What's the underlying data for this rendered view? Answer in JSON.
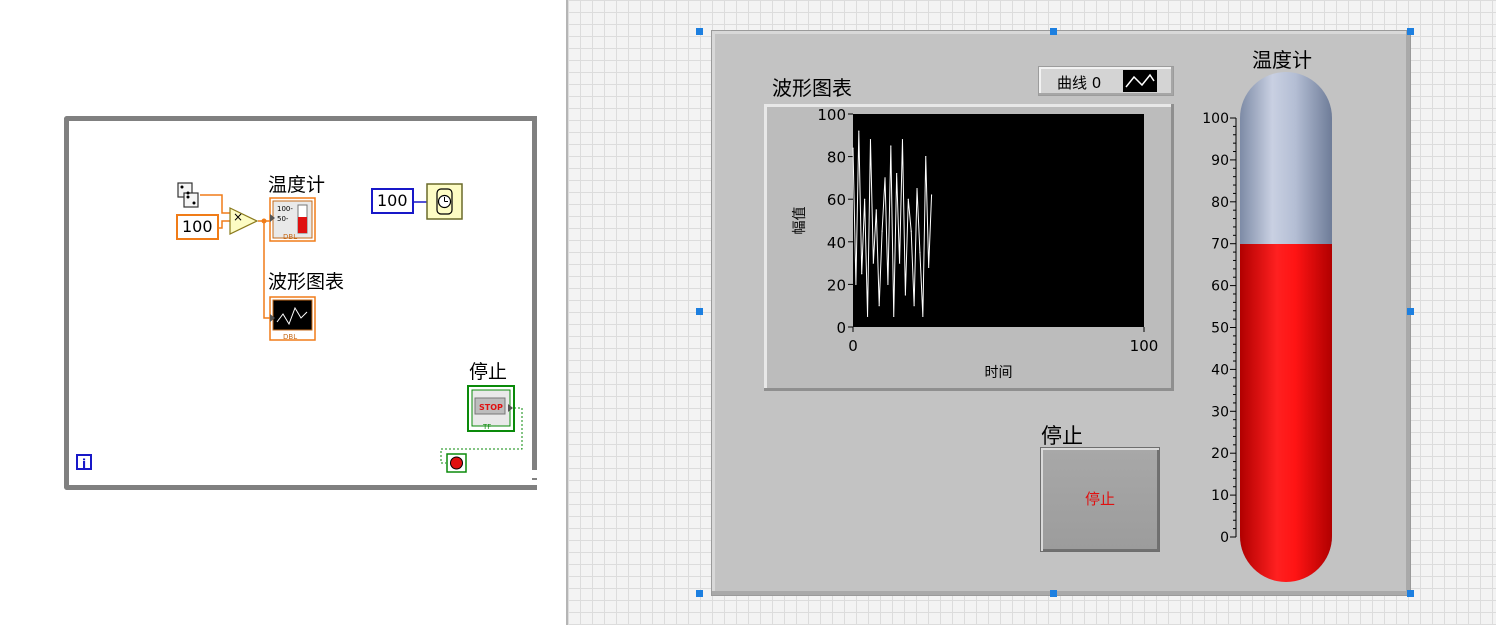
{
  "block_diagram": {
    "random_constant": "100",
    "multiply_symbol": "×",
    "thermometer_label": "温度计",
    "thermometer_icon_text": "DBL",
    "waveform_chart_label": "波形图表",
    "waveform_icon_text": "DBL",
    "wait_constant": "100",
    "stop_label": "停止",
    "stop_icon_text": "STOP",
    "stop_tf": "TF",
    "iteration_terminal": "i"
  },
  "front_panel": {
    "waveform_chart": {
      "title": "波形图表",
      "legend_label": "曲线 0"
    },
    "stop_button": {
      "label": "停止",
      "text": "停止"
    },
    "thermometer": {
      "title": "温度计",
      "value": 70,
      "scale_min": 0,
      "scale_max": 100
    }
  },
  "chart_data": {
    "type": "line",
    "title": "波形图表",
    "xlabel": "时间",
    "ylabel": "幅值",
    "xlim": [
      0,
      100
    ],
    "ylim": [
      0,
      100
    ],
    "x_ticks": [
      "0",
      "100"
    ],
    "y_ticks": [
      "0",
      "20",
      "40",
      "60",
      "80",
      "100"
    ],
    "grid": false,
    "background": "#000000",
    "line_color": "#ffffff",
    "series": [
      {
        "name": "曲线 0",
        "values": [
          84,
          20,
          92,
          25,
          60,
          5,
          88,
          30,
          55,
          10,
          45,
          70,
          20,
          85,
          5,
          72,
          30,
          88,
          15,
          60,
          45,
          10,
          65,
          35,
          5,
          80,
          28,
          62
        ]
      }
    ]
  },
  "colors": {
    "accent": "#1c7fe0",
    "stop_text": "#e01010",
    "thermo_fill": "#ff2020",
    "thermo_empty": "#b4bed4"
  }
}
